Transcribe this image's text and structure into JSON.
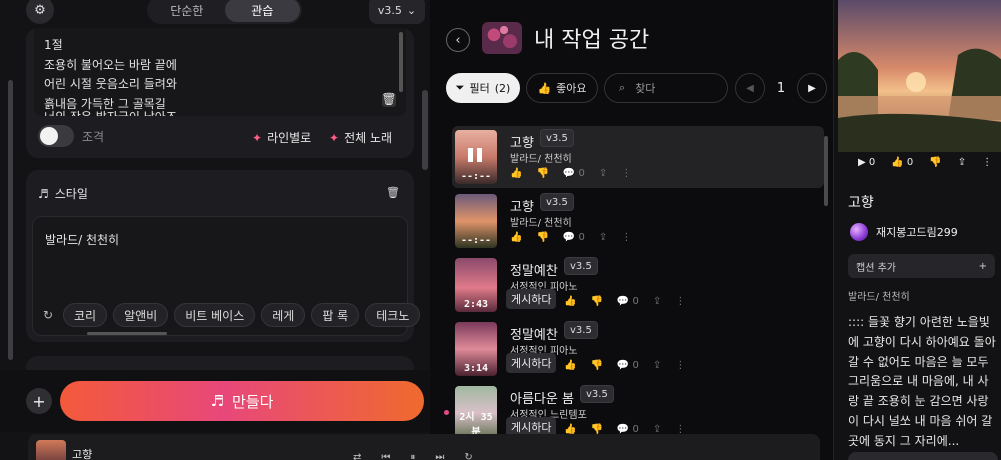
{
  "left": {
    "mode_tabs": [
      "단순한",
      "관습"
    ],
    "active_mode": "관습",
    "version": "v3.5",
    "lyrics_lines": [
      "1절",
      "조용히 불어오는 바람 끝에",
      "어린 시절 웃음소리 들려와",
      "흙내음 가득한 그 골목길",
      "너의 작은 발자국이 남아즈"
    ],
    "instrumental_label": "조격",
    "by_line_label": "라인별로",
    "full_song_label": "전체 노래",
    "style_title": "스타일",
    "style_text": "발라드/ 천천히",
    "style_tags": [
      "코리",
      "알앤비",
      "비트 베이스",
      "레게",
      "팝 록",
      "테크노"
    ],
    "create_label": "만들다"
  },
  "middle": {
    "title": "내 작업 공간",
    "filter_label": "필터",
    "filter_count": "(2)",
    "likes_label": "좋아요",
    "search_placeholder": "찾다",
    "page": "1",
    "songs": [
      {
        "title": "고향",
        "version": "v3.5",
        "style": "발라드/ 천천히",
        "duration": "--:--",
        "playing": true,
        "count": "0",
        "post": ""
      },
      {
        "title": "고향",
        "version": "v3.5",
        "style": "발라드/ 천천히",
        "duration": "--:--",
        "playing": false,
        "count": "0",
        "post": ""
      },
      {
        "title": "정말예찬",
        "version": "v3.5",
        "style": "서정적인 피아노",
        "duration": "2:43",
        "playing": false,
        "count": "0",
        "post": "게시하다"
      },
      {
        "title": "정말예찬",
        "version": "v3.5",
        "style": "서정적인 피아노",
        "duration": "3:14",
        "playing": false,
        "count": "0",
        "post": "게시하다"
      },
      {
        "title": "아름다운 봄",
        "version": "v3.5",
        "style": "서정적인 느린템포",
        "duration": "2시 35분",
        "playing": false,
        "count": "0",
        "post": "게시하다"
      }
    ]
  },
  "player": {
    "title": "고향"
  },
  "right": {
    "plays": "0",
    "likes": "0",
    "song_title": "고향",
    "user": "재지봉고드림299",
    "caption_add": "캡션 추가",
    "genre": "발라드/ 천천히",
    "lyrics": ":::: 들꽃 향기 아련한 노을빛에 고향이 다시 하아예요 돌아갈 수 없어도 마음은 늘 모두 그리움으로 내 마음에, 내 사랑 끝 조용히 눈 감으면 사랑이 다시 널쏘 내 마음 쉬어 갈 곳에 동지 그 자리에..."
  },
  "colors": {
    "accent_pink": "#e8487a",
    "accent_orange": "#f35a3a"
  }
}
